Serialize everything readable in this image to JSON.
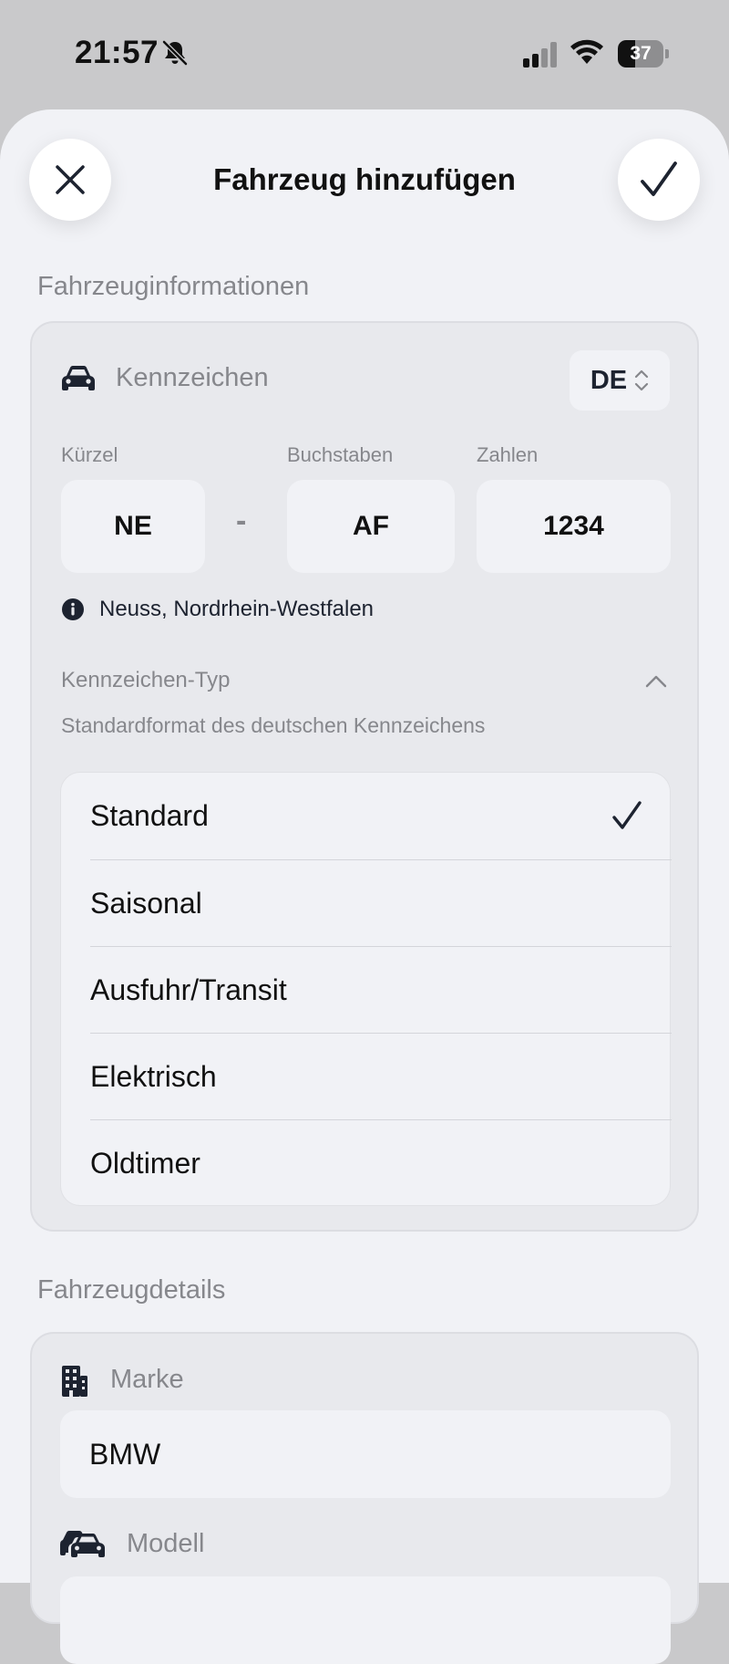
{
  "status_bar": {
    "time": "21:57",
    "battery": "37",
    "battery_level": 0.37
  },
  "header": {
    "title": "Fahrzeug hinzufügen",
    "close_icon": "close-icon",
    "confirm_icon": "checkmark-icon"
  },
  "vehicle_info": {
    "section_title": "Fahrzeuginformationen",
    "plate_label": "Kennzeichen",
    "country_code": "DE",
    "fields": {
      "kuerzel_label": "Kürzel",
      "kuerzel_value": "NE",
      "separator": "-",
      "buchstaben_label": "Buchstaben",
      "buchstaben_value": "AF",
      "zahlen_label": "Zahlen",
      "zahlen_value": "1234"
    },
    "region_info": "Neuss, Nordrhein-Westfalen",
    "plate_type": {
      "label": "Kennzeichen-Typ",
      "description": "Standardformat des deutschen Kennzeichens",
      "options": [
        {
          "label": "Standard",
          "selected": true
        },
        {
          "label": "Saisonal",
          "selected": false
        },
        {
          "label": "Ausfuhr/Transit",
          "selected": false
        },
        {
          "label": "Elektrisch",
          "selected": false
        },
        {
          "label": "Oldtimer",
          "selected": false
        }
      ]
    }
  },
  "vehicle_details": {
    "section_title": "Fahrzeugdetails",
    "brand_label": "Marke",
    "brand_value": "BMW",
    "model_label": "Modell"
  },
  "colors": {
    "accent_dark": "#1d2330",
    "background": "#f1f2f6",
    "card": "#e8e9ed",
    "muted_text": "#86878c"
  }
}
